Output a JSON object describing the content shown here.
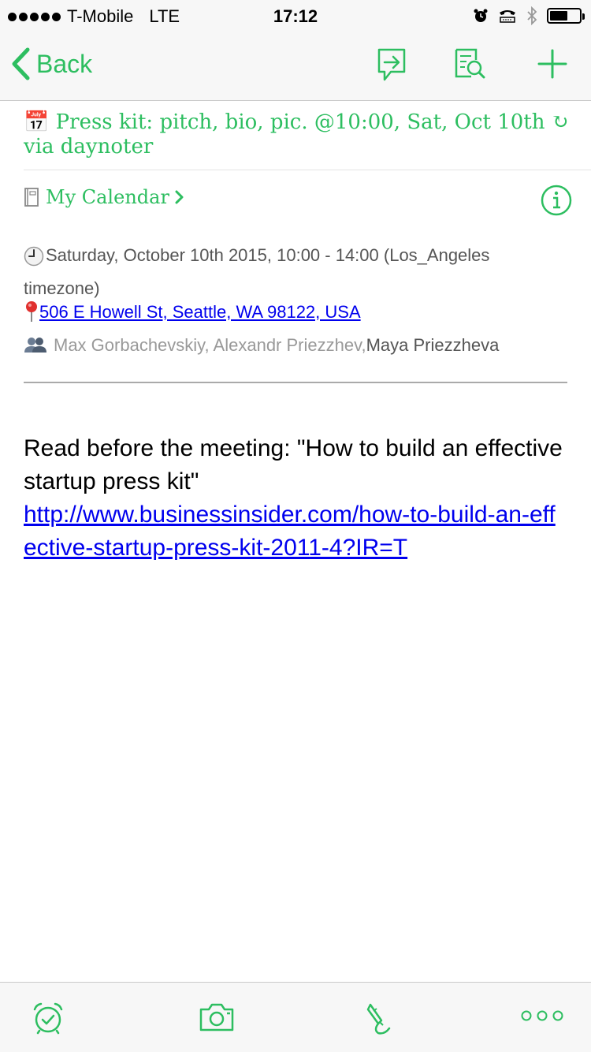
{
  "status_bar": {
    "carrier": "T-Mobile",
    "network": "LTE",
    "time": "17:12",
    "battery_level": 0.6
  },
  "nav": {
    "back_label": "Back",
    "accent_color": "#2dbe60",
    "icons": [
      "share-icon",
      "search-note-icon",
      "add-icon"
    ]
  },
  "note": {
    "title_emoji": "📅",
    "title": "Press kit: pitch, bio, pic. @10:00, Sat, Oct 10th ↻ via daynoter",
    "notebook": "My Calendar",
    "event_time": "Saturday, October 10th 2015, 10:00 - 14:00 (Los_Angeles timezone)",
    "location": "506 E Howell St, Seattle, WA 98122, USA",
    "attendees": {
      "names": "Max Gorbachevskiy, Alexandr Priezzhev, ",
      "last": "Maya Priezzheva"
    },
    "body_text": "Read before the meeting: \"How to build an effective startup press kit\"",
    "body_link": "http://www.businessinsider.com/how-to-build-an-effective-startup-press-kit-2011-4?IR=T"
  },
  "toolbar": {
    "icons": [
      "reminder-alarm-icon",
      "camera-icon",
      "handwriting-icon",
      "more-icon"
    ]
  }
}
